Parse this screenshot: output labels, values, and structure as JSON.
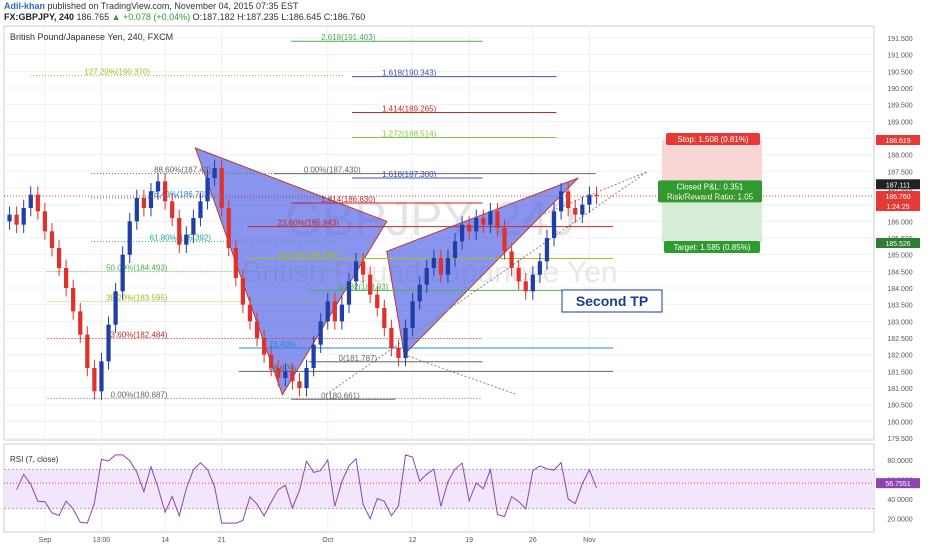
{
  "header": {
    "author": "Adil-khan",
    "published": " published on TradingView.com, November 04, 2015 07:35 EST",
    "symbol_line": "FX:GBPJPY, 240",
    "last": "186.765",
    "change": "+0.078 (+0.04%)",
    "ohlc": "O:187.182 H:187.235 L:186.645 C:186.760"
  },
  "chart_data": {
    "type": "candlestick",
    "title": "British Pound/Japanese Yen, 240, FXCM",
    "watermark": "GBPJPY, 240",
    "watermark_sub": "British Pound/Japanese Yen",
    "ylim": [
      179.5,
      191.8
    ],
    "y_ticks": [
      "191.500",
      "191.000",
      "190.500",
      "190.000",
      "189.500",
      "189.000",
      "188.500",
      "188.000",
      "187.500",
      "187.000",
      "186.500",
      "186.000",
      "185.500",
      "185.000",
      "184.500",
      "184.000",
      "183.500",
      "183.000",
      "182.500",
      "182.000",
      "181.500",
      "181.000",
      "180.500",
      "180.000",
      "179.500"
    ],
    "x_ticks": [
      {
        "label": "Sep",
        "i": 5
      },
      {
        "label": "13:00",
        "i": 13
      },
      {
        "label": "14",
        "i": 22
      },
      {
        "label": "21",
        "i": 30
      },
      {
        "label": "Oct",
        "i": 45
      },
      {
        "label": "12",
        "i": 57
      },
      {
        "label": "19",
        "i": 65
      },
      {
        "label": "26",
        "i": 74
      },
      {
        "label": "Nov",
        "i": 82
      }
    ],
    "close": [
      186.2,
      185.9,
      186.4,
      186.8,
      186.3,
      185.7,
      185.2,
      184.6,
      184.0,
      183.3,
      182.6,
      181.6,
      180.9,
      181.8,
      182.9,
      183.9,
      185.0,
      186.0,
      186.7,
      186.4,
      186.9,
      187.2,
      186.6,
      186.1,
      185.3,
      185.6,
      186.1,
      186.6,
      187.3,
      187.6,
      186.4,
      185.2,
      184.3,
      183.5,
      183.0,
      182.5,
      182.0,
      181.6,
      181.3,
      181.5,
      181.2,
      181.0,
      181.6,
      182.3,
      183.0,
      183.6,
      183.0,
      183.5,
      184.2,
      184.8,
      184.4,
      183.8,
      183.4,
      182.8,
      182.2,
      181.9,
      182.8,
      183.6,
      184.1,
      184.6,
      184.9,
      184.4,
      184.9,
      185.4,
      185.9,
      185.7,
      186.1,
      185.9,
      186.3,
      185.8,
      185.1,
      184.6,
      184.2,
      183.9,
      184.4,
      184.8,
      185.5,
      186.3,
      186.9,
      186.4,
      186.2,
      186.5,
      186.8,
      186.76
    ],
    "fib_levels": [
      {
        "label": "2.618(191.403)",
        "y": 191.403,
        "color": "#4caf50",
        "x0": 0.33,
        "x1": 0.55
      },
      {
        "label": "1.618(190.343)",
        "y": 190.343,
        "color": "#3f51b5",
        "x0": 0.4,
        "x1": 0.635
      },
      {
        "label": "127.20%(190.370)",
        "y": 190.37,
        "color": "#a0c020",
        "x0": 0.03,
        "x1": 0.39,
        "left": true
      },
      {
        "label": "1.414(189.265)",
        "y": 189.265,
        "color": "#c62828",
        "x0": 0.4,
        "x1": 0.635
      },
      {
        "label": "1.272(188.514)",
        "y": 188.514,
        "color": "#8bc34a",
        "x0": 0.4,
        "x1": 0.635
      },
      {
        "label": "0.00%(187.430)",
        "y": 187.43,
        "color": "#666",
        "x0": 0.31,
        "x1": 0.68
      },
      {
        "label": "1.618(187.300)",
        "y": 187.3,
        "color": "#3f51b5",
        "x0": 0.4,
        "x1": 0.55
      },
      {
        "label": "88.60%(187.43)",
        "y": 187.43,
        "color": "#666",
        "x0": 0.1,
        "x1": 0.38,
        "left": true
      },
      {
        "label": "76.40%(186.703)",
        "y": 186.703,
        "color": "#1e88e5",
        "x0": 0.1,
        "x1": 0.38,
        "left": true
      },
      {
        "label": "1.414(186.830)",
        "y": 186.55,
        "color": "#c62828",
        "x0": 0.33,
        "x1": 0.55
      },
      {
        "label": "23.60%(185.843)",
        "y": 185.843,
        "color": "#c62828",
        "x0": 0.28,
        "x1": 0.7
      },
      {
        "label": "61.80%(185.392)",
        "y": 185.392,
        "color": "#26a69a",
        "x0": 0.1,
        "x1": 0.38,
        "left": true
      },
      {
        "label": "38.20%(184.884)",
        "y": 184.884,
        "color": "#a0c020",
        "x0": 0.28,
        "x1": 0.7
      },
      {
        "label": "50.00%(184.493)",
        "y": 184.493,
        "color": "#4caf50",
        "x0": 0.05,
        "x1": 0.38,
        "left": true
      },
      {
        "label": "38.20%(183.595)",
        "y": 183.595,
        "color": "#a0c020",
        "x0": 0.05,
        "x1": 0.38,
        "left": true
      },
      {
        "label": "0.382(183.93)",
        "y": 183.93,
        "color": "#4caf50",
        "x0": 0.35,
        "x1": 0.7
      },
      {
        "label": "23.60%(182.484)",
        "y": 182.484,
        "color": "#c62828",
        "x0": 0.05,
        "x1": 0.55,
        "left": true
      },
      {
        "label": "76.40%",
        "y": 182.2,
        "color": "#1e88e5",
        "x0": 0.27,
        "x1": 0.7
      },
      {
        "label": "88.60%",
        "y": 181.5,
        "color": "#666",
        "x0": 0.27,
        "x1": 0.7
      },
      {
        "label": "0(181.787)",
        "y": 181.787,
        "color": "#666",
        "x0": 0.35,
        "x1": 0.55
      },
      {
        "label": "0.00%(180.687)",
        "y": 180.687,
        "color": "#666",
        "x0": 0.05,
        "x1": 0.55,
        "left": true
      },
      {
        "label": "0(180.661)",
        "y": 180.661,
        "color": "#666",
        "x0": 0.33,
        "x1": 0.45
      }
    ],
    "pattern1": [
      [
        0.22,
        188.2
      ],
      [
        0.32,
        180.8
      ],
      [
        0.44,
        186.0
      ]
    ],
    "pattern2": [
      [
        0.44,
        185.1
      ],
      [
        0.46,
        182.0
      ],
      [
        0.66,
        187.3
      ]
    ],
    "position": {
      "stop_label": "Stop: 1.508 (0.81%)",
      "pnl_label": "Closed P&L: 0.351",
      "rr_label": "Risk/Reward Ratio: 1.05",
      "target_label": "Target: 1.585 (0.85%)",
      "entry": 186.93,
      "stop": 188.44,
      "target": 185.35
    },
    "annotation": "Second TP",
    "price_tags": [
      {
        "text": "188.619",
        "y": 188.44,
        "color": "#e53935"
      },
      {
        "text": "187.111",
        "y": 187.111,
        "color": "#222"
      },
      {
        "text": "186.760",
        "y": 186.76,
        "color": "#e53935"
      },
      {
        "text": "1:24:25",
        "y": 186.46,
        "color": "#e53935"
      },
      {
        "text": "185.526",
        "y": 185.35,
        "color": "#2e7d32"
      }
    ]
  },
  "rsi": {
    "label": "RSI (7, close)",
    "ylim": [
      10,
      90
    ],
    "ticks": [
      "80.0000",
      "60.0000",
      "40.0000",
      "20.0000"
    ],
    "upper": 70,
    "lower": 30,
    "current": 56.0,
    "current_tag": "56.7551"
  }
}
